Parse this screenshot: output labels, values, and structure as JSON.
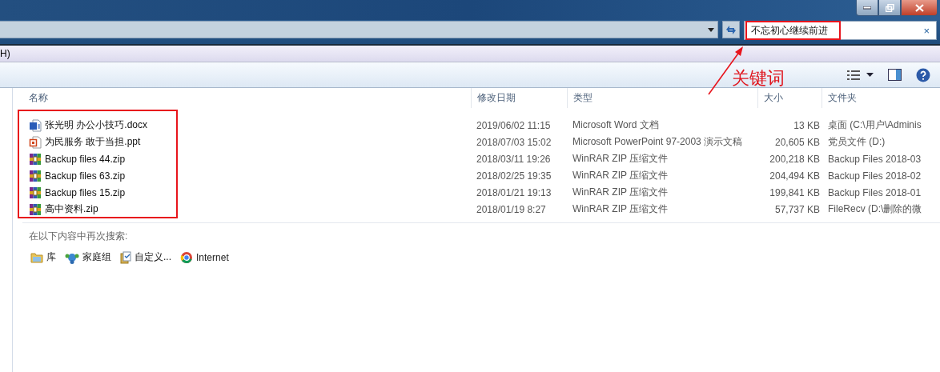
{
  "search": {
    "value": "不忘初心继续前进",
    "clear_glyph": "×"
  },
  "menu_bar": {
    "items": [
      "H)"
    ]
  },
  "annotation": {
    "label": "关键词"
  },
  "columns": [
    "名称",
    "修改日期",
    "类型",
    "大小",
    "文件夹"
  ],
  "rows": [
    {
      "kind": "word",
      "name": "张光明 办公小技巧.docx",
      "modified": "2019/06/02 11:15",
      "type": "Microsoft Word 文档",
      "size": "13 KB",
      "folder": "桌面 (C:\\用户\\Adminis"
    },
    {
      "kind": "ppt",
      "name": "为民服务  敢于当担.ppt",
      "modified": "2018/07/03 15:02",
      "type": "Microsoft PowerPoint 97-2003 演示文稿",
      "size": "20,605 KB",
      "folder": "党员文件 (D:)"
    },
    {
      "kind": "zip",
      "name": "Backup files 44.zip",
      "modified": "2018/03/11 19:26",
      "type": "WinRAR ZIP 压缩文件",
      "size": "200,218 KB",
      "folder": "Backup Files 2018-03"
    },
    {
      "kind": "zip",
      "name": "Backup files 63.zip",
      "modified": "2018/02/25 19:35",
      "type": "WinRAR ZIP 压缩文件",
      "size": "204,494 KB",
      "folder": "Backup Files 2018-02"
    },
    {
      "kind": "zip",
      "name": "Backup files 15.zip",
      "modified": "2018/01/21 19:13",
      "type": "WinRAR ZIP 压缩文件",
      "size": "199,841 KB",
      "folder": "Backup Files 2018-01"
    },
    {
      "kind": "zip",
      "name": "高中资料.zip",
      "modified": "2018/01/19 8:27",
      "type": "WinRAR ZIP 压缩文件",
      "size": "57,737 KB",
      "folder": "FileRecv (D:\\删除的微"
    }
  ],
  "search_again": {
    "label": "在以下内容中再次搜索:",
    "locations": [
      {
        "kind": "library",
        "label": "库"
      },
      {
        "kind": "homegroup",
        "label": "家庭组"
      },
      {
        "kind": "custom",
        "label": "自定义..."
      },
      {
        "kind": "internet",
        "label": "Internet"
      }
    ]
  }
}
